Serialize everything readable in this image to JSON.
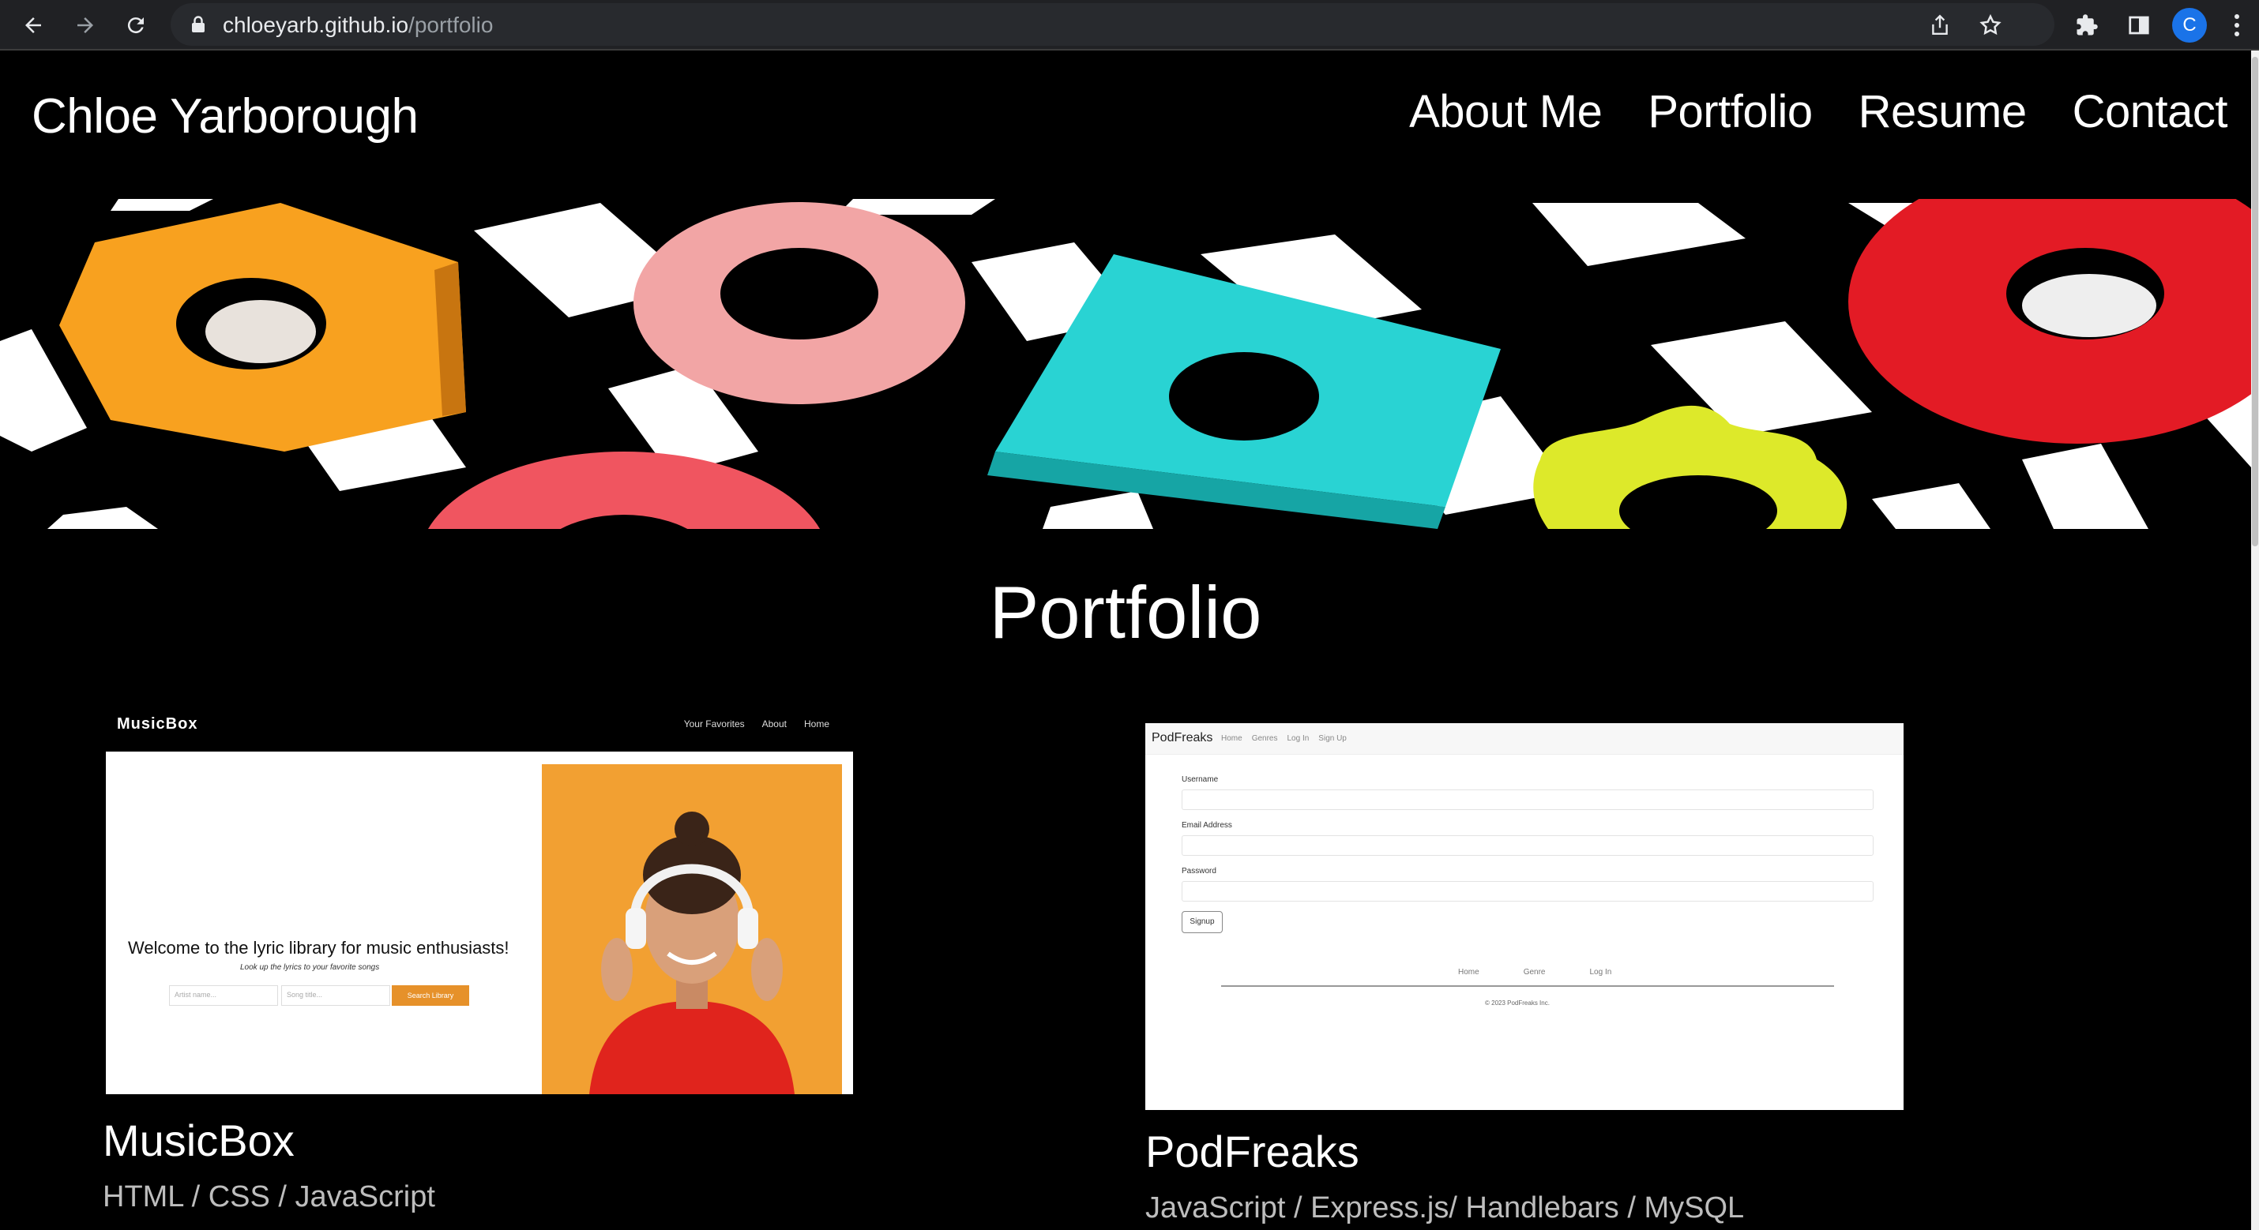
{
  "browser": {
    "url_host": "chloeyarb.github.io",
    "url_path": "/portfolio",
    "profile_initial": "C"
  },
  "site": {
    "title": "Chloe Yarborough",
    "nav": [
      "About Me",
      "Portfolio",
      "Resume",
      "Contact"
    ]
  },
  "portfolio": {
    "heading": "Portfolio",
    "projects": [
      {
        "title": "MusicBox",
        "tech": "HTML / CSS / JavaScript",
        "preview": {
          "logo": "MusicBox",
          "links": [
            "Your Favorites",
            "About",
            "Home"
          ],
          "welcome": "Welcome to the lyric library for music enthusiasts!",
          "subtitle": "Look up the lyrics to your favorite songs",
          "artist_placeholder": "Artist name...",
          "song_placeholder": "Song title...",
          "button": "Search Library"
        }
      },
      {
        "title": "PodFreaks",
        "tech": "JavaScript / Express.js/ Handlebars / MySQL",
        "preview": {
          "brand": "PodFreaks",
          "links": [
            "Home",
            "Genres",
            "Log In",
            "Sign Up"
          ],
          "username_label": "Username",
          "email_label": "Email Address",
          "password_label": "Password",
          "button": "Signup",
          "footer_links": [
            "Home",
            "Genre",
            "Log In"
          ],
          "copyright": "© 2023 PodFreaks Inc."
        }
      }
    ]
  }
}
